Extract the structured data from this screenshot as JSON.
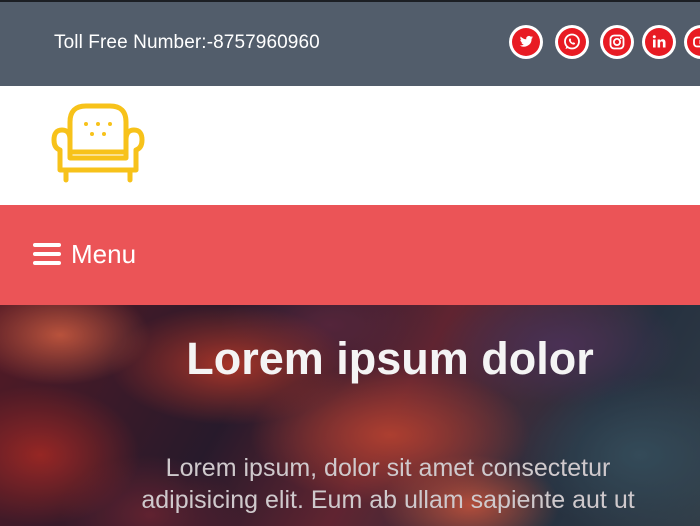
{
  "topbar": {
    "toll_free": "Toll Free Number:-8757960960",
    "social": [
      {
        "icon": "twitter-icon"
      },
      {
        "icon": "whatsapp-icon"
      },
      {
        "icon": "instagram-icon"
      },
      {
        "icon": "linkedin-icon"
      },
      {
        "icon": "youtube-icon"
      }
    ],
    "accent_color": "#e81b23"
  },
  "logo": {
    "icon": "armchair-icon",
    "color": "#f7c21a"
  },
  "nav": {
    "menu_label": "Menu",
    "background": "#eb5457"
  },
  "hero": {
    "title": "Lorem ipsum dolor",
    "text_line1": "Lorem ipsum, dolor sit amet consectetur",
    "text_line2": "adipisicing elit. Eum ab ullam sapiente aut ut"
  }
}
